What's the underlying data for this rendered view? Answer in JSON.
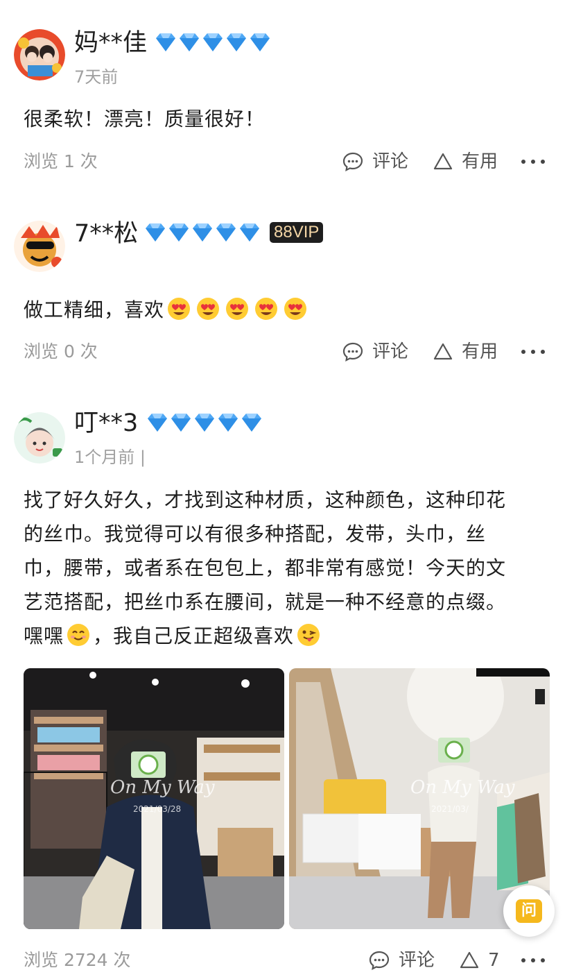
{
  "reviews": [
    {
      "username": "妈**佳",
      "diamond_count": 5,
      "time": "7天前",
      "content": "很柔软！漂亮！质量很好！",
      "views": "浏览 1 次",
      "comment_label": "评论",
      "useful_label": "有用"
    },
    {
      "username": "7**松",
      "diamond_count": 5,
      "badge": "88VIP",
      "content": "做工精细，喜欢",
      "emoji": "heart-eyes x5",
      "views": "浏览 0 次",
      "comment_label": "评论",
      "useful_label": "有用"
    },
    {
      "username": "叮**3",
      "diamond_count": 5,
      "time": "1个月前 |",
      "content_lines": [
        "找了好久好久，才找到这种材质，这种颜色，这种印花",
        "的丝巾。我觉得可以有很多种搭配，发带，头巾，丝",
        "巾，腰带，或者系在包包上，都非常有感觉！今天的文",
        "艺范搭配，把丝巾系在腰间，就是一种不经意的点缀。"
      ],
      "last_line_a": "嘿嘿",
      "last_line_b": "，我自己反正超级喜欢",
      "photos": [
        {
          "watermark": "On My Way",
          "date": "2021/03/28"
        },
        {
          "watermark": "On My Way",
          "date": "2021/03/"
        }
      ],
      "views": "浏览 2724 次",
      "comment_label": "评论",
      "useful_count": "7"
    }
  ],
  "ask_button": "问",
  "colors": {
    "diamond": "#4fa8f5",
    "muted": "#9a9a9a",
    "ask": "#f5b81d"
  }
}
